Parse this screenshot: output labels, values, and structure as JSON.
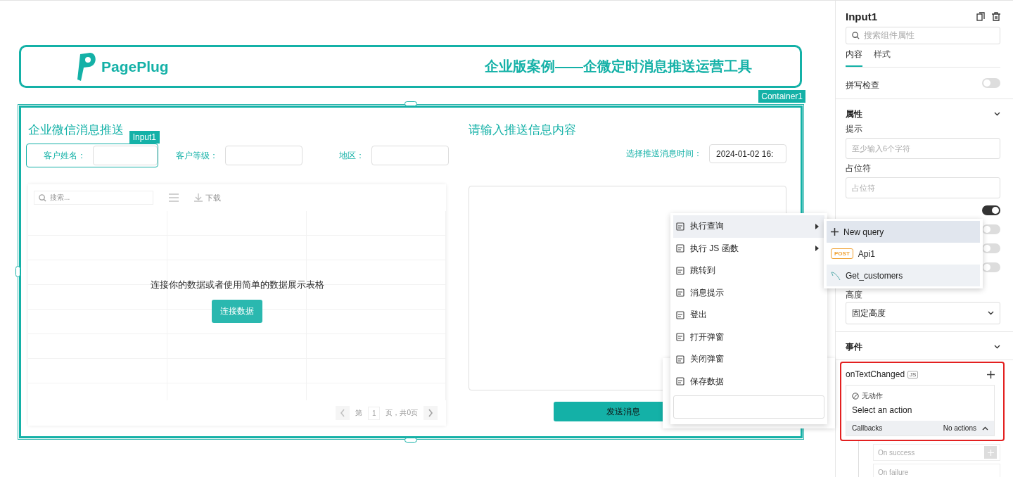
{
  "header": {
    "logo": "PagePlug",
    "title": "企业版案例——企微定时消息推送运营工具"
  },
  "container_label": "Container1",
  "left": {
    "heading": "企业微信消息推送",
    "selected_widget_label": "Input1",
    "fields": [
      {
        "label": "客户姓名：",
        "selected": true
      },
      {
        "label": "客户等级：",
        "selected": false
      },
      {
        "label": "地区：",
        "selected": false
      }
    ],
    "table": {
      "search_placeholder": "搜索...",
      "download": "下载",
      "empty_message": "连接你的数据或者使用简单的数据展示表格",
      "connect_button": "连接数据",
      "page_prefix": "第",
      "page": "1",
      "page_suffix": "页，共0页"
    }
  },
  "right": {
    "heading": "请输入推送信息内容",
    "time_label": "选择推送消息时间：",
    "time_value": "2024-01-02 16:",
    "send_button": "发送消息"
  },
  "context_menu": {
    "items": [
      {
        "label": "执行查询",
        "submenu": true,
        "selected": true
      },
      {
        "label": "执行 JS 函数",
        "submenu": true,
        "selected": false
      },
      {
        "label": "跳转到",
        "submenu": false,
        "selected": false
      },
      {
        "label": "消息提示",
        "submenu": false,
        "selected": false
      },
      {
        "label": "登出",
        "submenu": false,
        "selected": false
      },
      {
        "label": "打开弹窗",
        "submenu": false,
        "selected": false
      },
      {
        "label": "关闭弹窗",
        "submenu": false,
        "selected": false
      },
      {
        "label": "保存数据",
        "submenu": false,
        "selected": false
      }
    ]
  },
  "submenu": {
    "items": [
      {
        "kind": "new",
        "label": "New query",
        "selected": true,
        "hovered": false
      },
      {
        "kind": "api",
        "badge": "POST",
        "label": "Api1",
        "selected": false,
        "hovered": false
      },
      {
        "kind": "db",
        "label": "Get_customers",
        "selected": false,
        "hovered": true
      }
    ]
  },
  "panel": {
    "title": "Input1",
    "search_placeholder": "搜索组件属性",
    "tabs": [
      {
        "label": "内容",
        "selected": true
      },
      {
        "label": "样式",
        "selected": false
      }
    ],
    "spellcheck": {
      "label": "拼写检查",
      "on": false
    },
    "properties": {
      "title": "属性",
      "hint_label": "提示",
      "hint_placeholder": "至少输入6个字符",
      "placeholder_label": "占位符",
      "placeholder_placeholder": "占位符",
      "toggles": [
        {
          "on": true
        },
        {
          "on": false
        },
        {
          "on": false
        },
        {
          "on": false
        }
      ],
      "height_label": "高度",
      "height_value": "固定高度"
    },
    "events": {
      "title": "事件",
      "event": "onTextChanged",
      "js": "JS",
      "no_action": "无动作",
      "select_action": "Select an action",
      "callbacks": "Callbacks",
      "no_actions": "No actions",
      "on_success": "On success",
      "on_failure": "On failure"
    }
  }
}
